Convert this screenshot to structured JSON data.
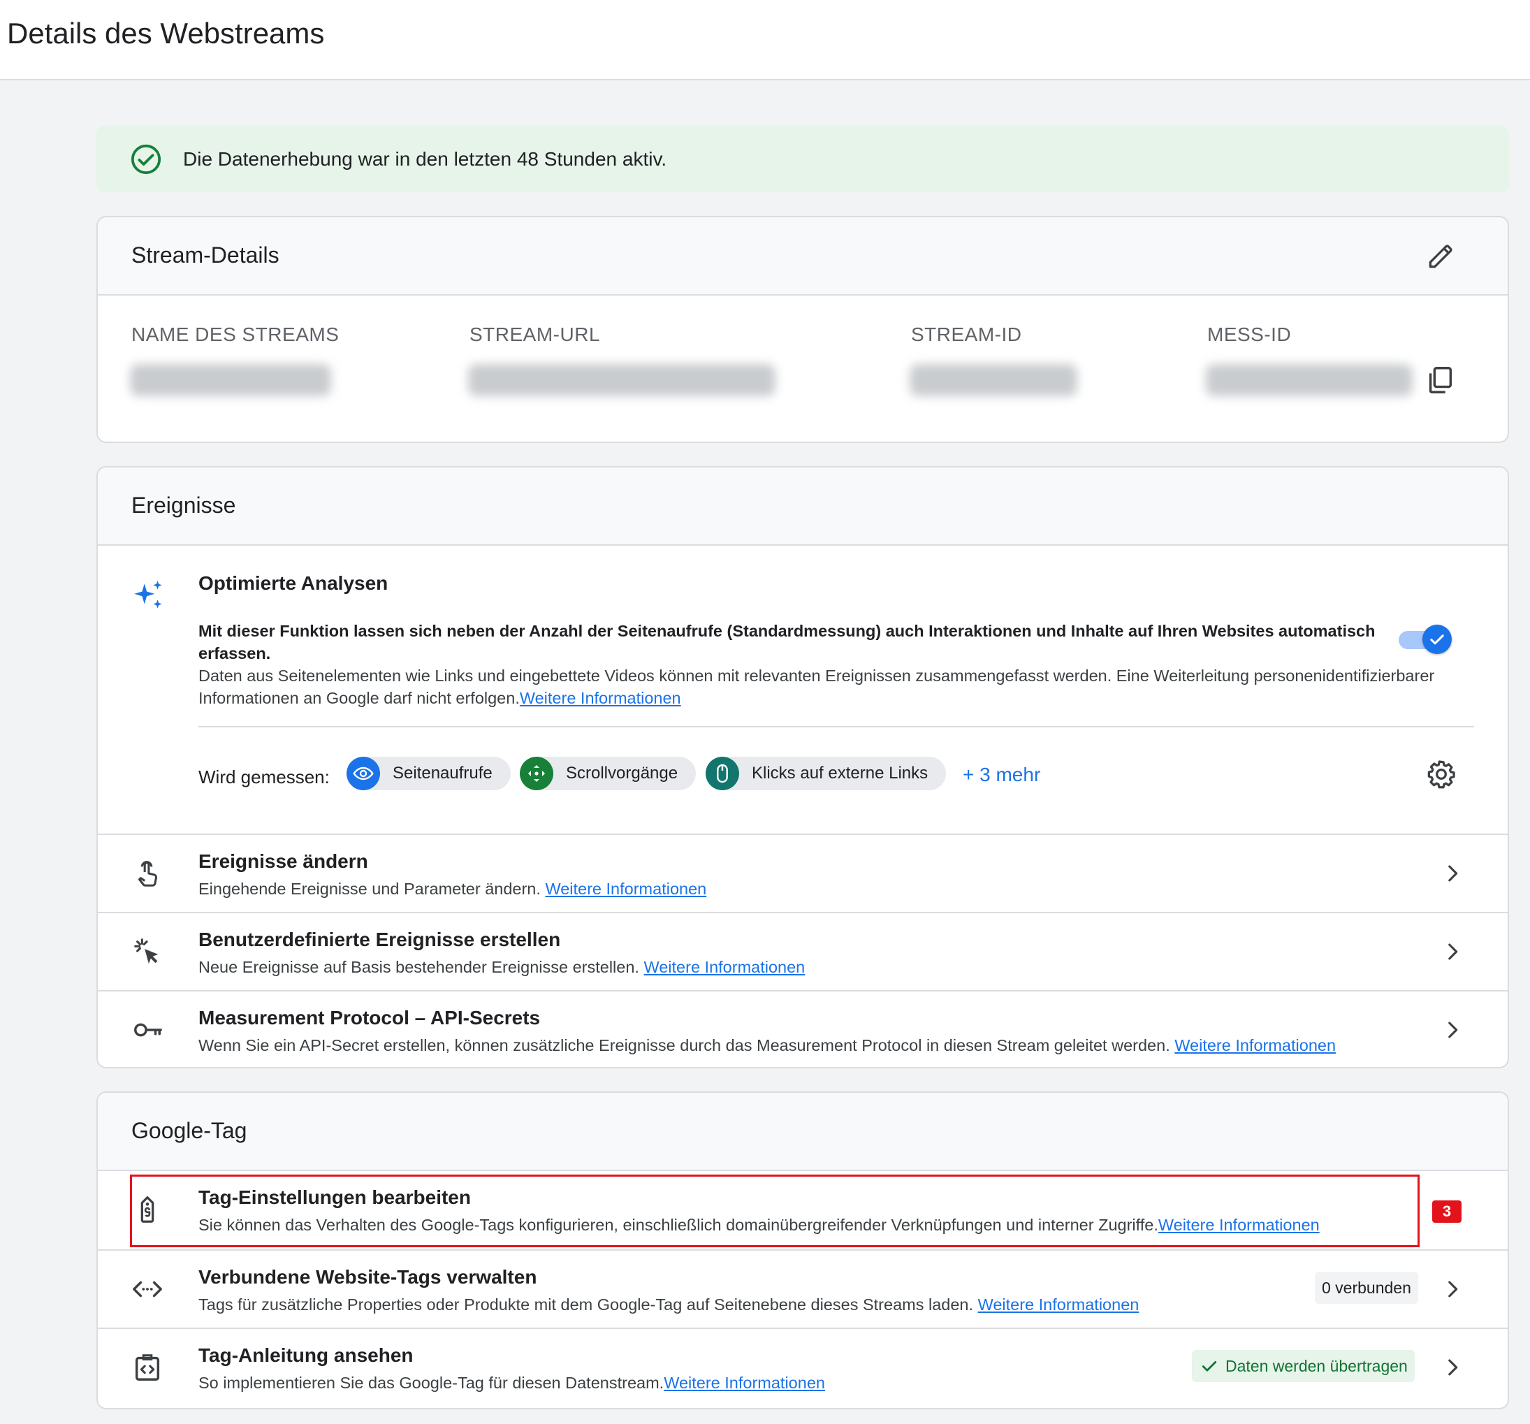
{
  "page": {
    "title": "Details des Webstreams"
  },
  "banner": {
    "text": "Die Datenerhebung war in den letzten 48 Stunden aktiv.",
    "icon": "check-circle-icon"
  },
  "stream_details": {
    "title": "Stream-Details",
    "edit_icon": "pencil-icon",
    "fields": [
      {
        "label": "NAME DES STREAMS"
      },
      {
        "label": "STREAM-URL"
      },
      {
        "label": "STREAM-ID"
      },
      {
        "label": "MESS-ID"
      }
    ],
    "copy_icon": "copy-icon"
  },
  "events": {
    "title": "Ereignisse",
    "enhanced": {
      "title": "Optimierte Analysen",
      "description_bold": "Mit dieser Funktion lassen sich neben der Anzahl der Seitenaufrufe (Standardmessung) auch Interaktionen und Inhalte auf Ihren Websites automatisch erfassen.",
      "description": "Daten aus Seitenelementen wie Links und eingebettete Videos können mit relevanten Ereignissen zusammengefasst werden. Eine Weiterleitung personenidentifizierbarer Informationen an Google darf nicht erfolgen.",
      "link": "Weitere Informationen",
      "toggle_on": true,
      "measured_label": "Wird gemessen:",
      "chips": [
        {
          "label": "Seitenaufrufe",
          "icon": "eye-icon",
          "color": "#1a73e8"
        },
        {
          "label": "Scrollvorgänge",
          "icon": "scroll-icon",
          "color": "#188038"
        },
        {
          "label": "Klicks auf externe Links",
          "icon": "mouse-icon",
          "color": "#12766e"
        }
      ],
      "more": "+ 3 mehr"
    },
    "rows": [
      {
        "title": "Ereignisse ändern",
        "desc": "Eingehende Ereignisse und Parameter ändern.",
        "link": "Weitere Informationen",
        "icon": "touch-icon"
      },
      {
        "title": "Benutzerdefinierte Ereignisse erstellen",
        "desc": "Neue Ereignisse auf Basis bestehender Ereignisse erstellen.",
        "link": "Weitere Informationen",
        "icon": "click-sparkle-icon"
      },
      {
        "title": "Measurement Protocol – API-Secrets",
        "desc": "Wenn Sie ein API-Secret erstellen, können zusätzliche Ereignisse durch das Measurement Protocol in diesen Stream geleitet werden.",
        "link": "Weitere Informationen",
        "icon": "key-icon"
      }
    ]
  },
  "google_tag": {
    "title": "Google-Tag",
    "rows": [
      {
        "title": "Tag-Einstellungen bearbeiten",
        "desc": "Sie können das Verhalten des Google-Tags konfigurieren, einschließlich domainübergreifender Verknüpfungen und interner Zugriffe.",
        "link": "Weitere Informationen",
        "icon": "tag-icon"
      },
      {
        "title": "Verbundene Website-Tags verwalten",
        "desc": "Tags für zusätzliche Properties oder Produkte mit dem Google-Tag auf Seitenebene dieses Streams laden.",
        "link": "Weitere Informationen",
        "icon": "code-arrows-icon",
        "status": "0 verbunden"
      },
      {
        "title": "Tag-Anleitung ansehen",
        "desc": "So implementieren Sie das Google-Tag für diesen Datenstream.",
        "link": "Weitere Informationen",
        "icon": "clipboard-code-icon",
        "status": "Daten werden übertragen"
      }
    ]
  },
  "annotation": {
    "badge": "3",
    "color": "#e3131b"
  }
}
